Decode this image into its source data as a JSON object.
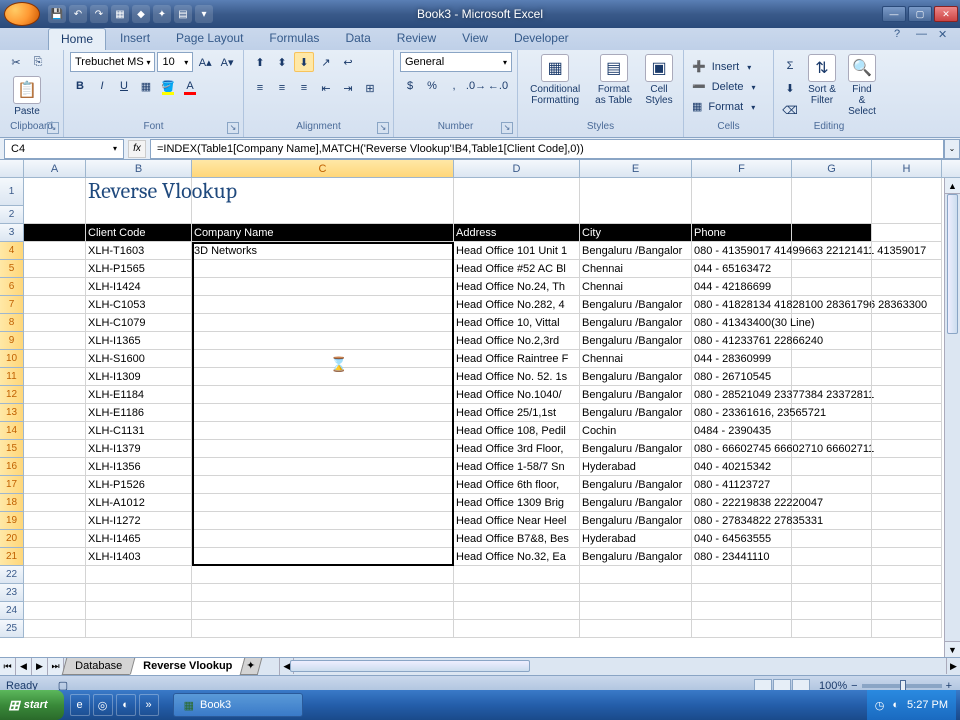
{
  "window": {
    "title": "Book3 - Microsoft Excel"
  },
  "ribbon": {
    "tabs": [
      "Home",
      "Insert",
      "Page Layout",
      "Formulas",
      "Data",
      "Review",
      "View",
      "Developer"
    ],
    "active_tab": "Home",
    "font_name": "Trebuchet MS",
    "font_size": "10",
    "number_format": "General",
    "groups": {
      "clipboard": "Clipboard",
      "font": "Font",
      "alignment": "Alignment",
      "number": "Number",
      "styles": "Styles",
      "cells": "Cells",
      "editing": "Editing"
    },
    "paste": "Paste",
    "cond_fmt": "Conditional Formatting",
    "fmt_table": "Format as Table",
    "cell_styles": "Cell Styles",
    "insert": "Insert",
    "delete": "Delete",
    "format": "Format",
    "sort_filter": "Sort & Filter",
    "find_select": "Find & Select"
  },
  "namebox": "C4",
  "formula": "=INDEX(Table1[Company Name],MATCH('Reverse Vlookup'!B4,Table1[Client Code],0))",
  "columns": [
    "A",
    "B",
    "C",
    "D",
    "E",
    "F",
    "G",
    "H"
  ],
  "title_cell": "Reverse Vlookup",
  "headers": {
    "client_code": "Client Code",
    "company": "Company Name",
    "address": "Address",
    "city": "City",
    "phone": "Phone"
  },
  "rows": [
    {
      "n": 4,
      "code": "XLH-T1603",
      "company": "3D Networks",
      "addr": "Head Office 101 Unit 1",
      "city": "Bengaluru /Bangalor",
      "phone": "080 - 41359017 41499663 22121411 41359017"
    },
    {
      "n": 5,
      "code": "XLH-P1565",
      "company": "",
      "addr": "Head Office #52 AC Bl",
      "city": "Chennai",
      "phone": "044 - 65163472"
    },
    {
      "n": 6,
      "code": "XLH-I1424",
      "company": "",
      "addr": "Head Office No.24, Th",
      "city": "Chennai",
      "phone": "044 - 42186699"
    },
    {
      "n": 7,
      "code": "XLH-C1053",
      "company": "",
      "addr": "Head Office No.282, 4",
      "city": "Bengaluru /Bangalor",
      "phone": "080 - 41828134 41828100 28361796 28363300"
    },
    {
      "n": 8,
      "code": "XLH-C1079",
      "company": "",
      "addr": "Head Office 10, Vittal",
      "city": "Bengaluru /Bangalor",
      "phone": "080 - 41343400(30 Line)"
    },
    {
      "n": 9,
      "code": "XLH-I1365",
      "company": "",
      "addr": "Head Office No.2,3rd",
      "city": "Bengaluru /Bangalor",
      "phone": "080 - 41233761 22866240"
    },
    {
      "n": 10,
      "code": "XLH-S1600",
      "company": "",
      "addr": "Head Office Raintree F",
      "city": "Chennai",
      "phone": "044 - 28360999"
    },
    {
      "n": 11,
      "code": "XLH-I1309",
      "company": "",
      "addr": "Head Office No. 52. 1s",
      "city": "Bengaluru /Bangalor",
      "phone": "080 - 26710545"
    },
    {
      "n": 12,
      "code": "XLH-E1184",
      "company": "",
      "addr": "Head Office No.1040/",
      "city": "Bengaluru /Bangalor",
      "phone": "080 - 28521049 23377384 23372811"
    },
    {
      "n": 13,
      "code": "XLH-E1186",
      "company": "",
      "addr": "Head Office 25/1,1st",
      "city": "Bengaluru /Bangalor",
      "phone": "080 - 23361616, 23565721"
    },
    {
      "n": 14,
      "code": "XLH-C1131",
      "company": "",
      "addr": "Head Office 108, Pedil",
      "city": "Cochin",
      "phone": "0484 - 2390435"
    },
    {
      "n": 15,
      "code": "XLH-I1379",
      "company": "",
      "addr": "Head Office 3rd Floor,",
      "city": "Bengaluru /Bangalor",
      "phone": "080 - 66602745 66602710 66602711"
    },
    {
      "n": 16,
      "code": "XLH-I1356",
      "company": "",
      "addr": "Head Office 1-58/7 Sn",
      "city": "Hyderabad",
      "phone": "040 - 40215342"
    },
    {
      "n": 17,
      "code": "XLH-P1526",
      "company": "",
      "addr": "Head Office 6th floor,",
      "city": "Bengaluru /Bangalor",
      "phone": "080 - 41123727"
    },
    {
      "n": 18,
      "code": "XLH-A1012",
      "company": "",
      "addr": "Head Office 1309 Brig",
      "city": "Bengaluru /Bangalor",
      "phone": "080 - 22219838 22220047"
    },
    {
      "n": 19,
      "code": "XLH-I1272",
      "company": "",
      "addr": "Head Office Near Heel",
      "city": "Bengaluru /Bangalor",
      "phone": "080 - 27834822 27835331"
    },
    {
      "n": 20,
      "code": "XLH-I1465",
      "company": "",
      "addr": "Head Office B7&8, Bes",
      "city": "Hyderabad",
      "phone": "040 - 64563555"
    },
    {
      "n": 21,
      "code": "XLH-I1403",
      "company": "",
      "addr": "Head Office No.32, Ea",
      "city": "Bengaluru /Bangalor",
      "phone": "080 - 23441110"
    }
  ],
  "empty_rows": [
    22,
    23,
    24,
    25
  ],
  "sheets": {
    "tabs": [
      "Database",
      "Reverse Vlookup"
    ],
    "active": "Reverse Vlookup"
  },
  "status": {
    "mode": "Ready",
    "zoom": "100%"
  },
  "taskbar": {
    "start": "start",
    "app": "Book3",
    "time": "5:27 PM"
  },
  "chart_data": null
}
